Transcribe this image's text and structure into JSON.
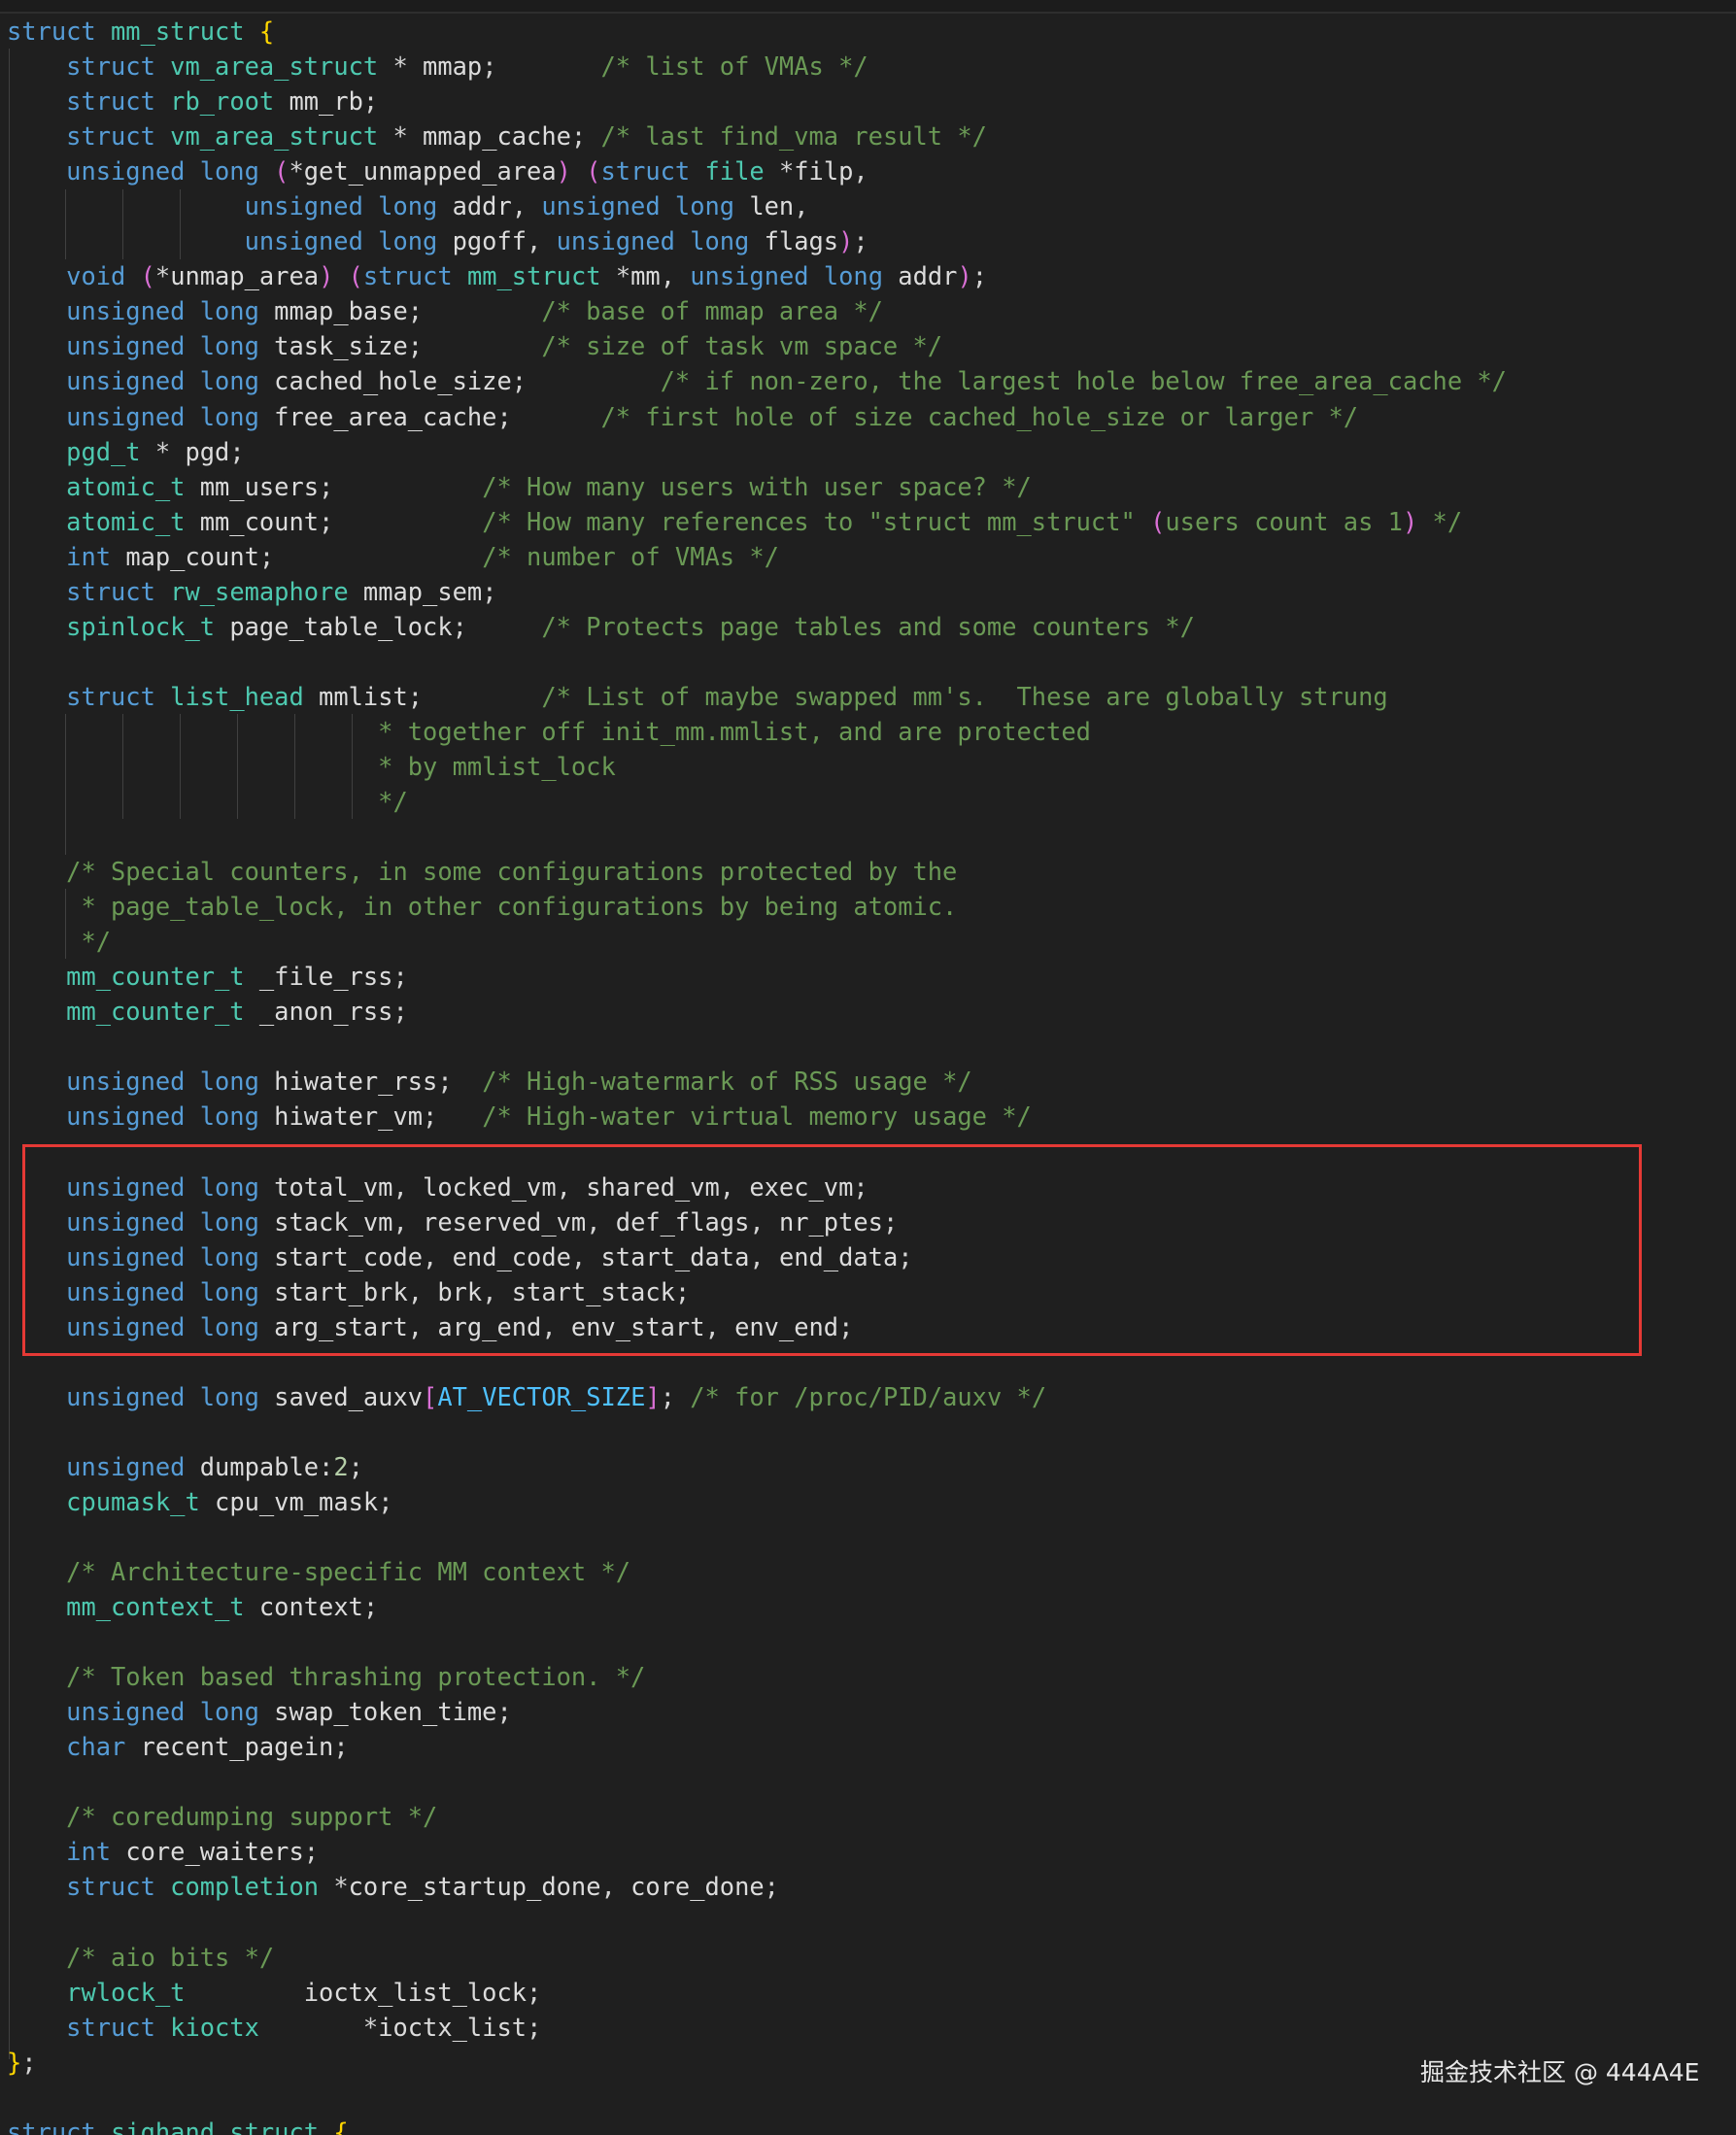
{
  "watermark": "掘金技术社区 @ 444A4E",
  "code_lines": [
    [
      {
        "t": "struct ",
        "c": "kw"
      },
      {
        "t": "mm_struct ",
        "c": "tp"
      },
      {
        "t": "{",
        "c": "br1"
      }
    ],
    [
      {
        "t": "    ",
        "c": "pn"
      },
      {
        "t": "struct ",
        "c": "kw"
      },
      {
        "t": "vm_area_struct ",
        "c": "tp"
      },
      {
        "t": "* ",
        "c": "pn"
      },
      {
        "t": "mmap",
        "c": "id"
      },
      {
        "t": ";       ",
        "c": "pn"
      },
      {
        "t": "/* list of VMAs */",
        "c": "cm"
      }
    ],
    [
      {
        "t": "    ",
        "c": "pn"
      },
      {
        "t": "struct ",
        "c": "kw"
      },
      {
        "t": "rb_root ",
        "c": "tp"
      },
      {
        "t": "mm_rb",
        "c": "id"
      },
      {
        "t": ";",
        "c": "pn"
      }
    ],
    [
      {
        "t": "    ",
        "c": "pn"
      },
      {
        "t": "struct ",
        "c": "kw"
      },
      {
        "t": "vm_area_struct ",
        "c": "tp"
      },
      {
        "t": "* ",
        "c": "pn"
      },
      {
        "t": "mmap_cache",
        "c": "id"
      },
      {
        "t": "; ",
        "c": "pn"
      },
      {
        "t": "/* last find_vma result */",
        "c": "cm"
      }
    ],
    [
      {
        "t": "    ",
        "c": "pn"
      },
      {
        "t": "unsigned long ",
        "c": "kw"
      },
      {
        "t": "(",
        "c": "br2"
      },
      {
        "t": "*",
        "c": "pn"
      },
      {
        "t": "get_unmapped_area",
        "c": "id"
      },
      {
        "t": ") (",
        "c": "br2"
      },
      {
        "t": "struct ",
        "c": "kw"
      },
      {
        "t": "file ",
        "c": "tp"
      },
      {
        "t": "*",
        "c": "pn"
      },
      {
        "t": "filp",
        "c": "id"
      },
      {
        "t": ",",
        "c": "pn"
      }
    ],
    [
      {
        "t": "                ",
        "c": "pn"
      },
      {
        "t": "unsigned long ",
        "c": "kw"
      },
      {
        "t": "addr",
        "c": "id"
      },
      {
        "t": ", ",
        "c": "pn"
      },
      {
        "t": "unsigned long ",
        "c": "kw"
      },
      {
        "t": "len",
        "c": "id"
      },
      {
        "t": ",",
        "c": "pn"
      }
    ],
    [
      {
        "t": "                ",
        "c": "pn"
      },
      {
        "t": "unsigned long ",
        "c": "kw"
      },
      {
        "t": "pgoff",
        "c": "id"
      },
      {
        "t": ", ",
        "c": "pn"
      },
      {
        "t": "unsigned long ",
        "c": "kw"
      },
      {
        "t": "flags",
        "c": "id"
      },
      {
        "t": ")",
        "c": "br2"
      },
      {
        "t": ";",
        "c": "pn"
      }
    ],
    [
      {
        "t": "    ",
        "c": "pn"
      },
      {
        "t": "void ",
        "c": "kw"
      },
      {
        "t": "(",
        "c": "br2"
      },
      {
        "t": "*",
        "c": "pn"
      },
      {
        "t": "unmap_area",
        "c": "id"
      },
      {
        "t": ") (",
        "c": "br2"
      },
      {
        "t": "struct ",
        "c": "kw"
      },
      {
        "t": "mm_struct ",
        "c": "tp"
      },
      {
        "t": "*",
        "c": "pn"
      },
      {
        "t": "mm",
        "c": "id"
      },
      {
        "t": ", ",
        "c": "pn"
      },
      {
        "t": "unsigned long ",
        "c": "kw"
      },
      {
        "t": "addr",
        "c": "id"
      },
      {
        "t": ")",
        "c": "br2"
      },
      {
        "t": ";",
        "c": "pn"
      }
    ],
    [
      {
        "t": "    ",
        "c": "pn"
      },
      {
        "t": "unsigned long ",
        "c": "kw"
      },
      {
        "t": "mmap_base",
        "c": "id"
      },
      {
        "t": ";        ",
        "c": "pn"
      },
      {
        "t": "/* base of mmap area */",
        "c": "cm"
      }
    ],
    [
      {
        "t": "    ",
        "c": "pn"
      },
      {
        "t": "unsigned long ",
        "c": "kw"
      },
      {
        "t": "task_size",
        "c": "id"
      },
      {
        "t": ";        ",
        "c": "pn"
      },
      {
        "t": "/* size of task vm space */",
        "c": "cm"
      }
    ],
    [
      {
        "t": "    ",
        "c": "pn"
      },
      {
        "t": "unsigned long ",
        "c": "kw"
      },
      {
        "t": "cached_hole_size",
        "c": "id"
      },
      {
        "t": ";         ",
        "c": "pn"
      },
      {
        "t": "/* if non-zero, the largest hole below free_area_cache */",
        "c": "cm"
      }
    ],
    [
      {
        "t": "    ",
        "c": "pn"
      },
      {
        "t": "unsigned long ",
        "c": "kw"
      },
      {
        "t": "free_area_cache",
        "c": "id"
      },
      {
        "t": ";      ",
        "c": "pn"
      },
      {
        "t": "/* first hole of size cached_hole_size or larger */",
        "c": "cm"
      }
    ],
    [
      {
        "t": "    ",
        "c": "pn"
      },
      {
        "t": "pgd_t ",
        "c": "tp"
      },
      {
        "t": "* ",
        "c": "pn"
      },
      {
        "t": "pgd",
        "c": "id"
      },
      {
        "t": ";",
        "c": "pn"
      }
    ],
    [
      {
        "t": "    ",
        "c": "pn"
      },
      {
        "t": "atomic_t ",
        "c": "tp"
      },
      {
        "t": "mm_users",
        "c": "id"
      },
      {
        "t": ";          ",
        "c": "pn"
      },
      {
        "t": "/* How many users with user space? */",
        "c": "cm"
      }
    ],
    [
      {
        "t": "    ",
        "c": "pn"
      },
      {
        "t": "atomic_t ",
        "c": "tp"
      },
      {
        "t": "mm_count",
        "c": "id"
      },
      {
        "t": ";          ",
        "c": "pn"
      },
      {
        "t": "/* How many references to \"struct mm_struct\" ",
        "c": "cm"
      },
      {
        "t": "(",
        "c": "br2"
      },
      {
        "t": "users count as 1",
        "c": "cm"
      },
      {
        "t": ")",
        "c": "br2"
      },
      {
        "t": " */",
        "c": "cm"
      }
    ],
    [
      {
        "t": "    ",
        "c": "pn"
      },
      {
        "t": "int ",
        "c": "kw"
      },
      {
        "t": "map_count",
        "c": "id"
      },
      {
        "t": ";              ",
        "c": "pn"
      },
      {
        "t": "/* number of VMAs */",
        "c": "cm"
      }
    ],
    [
      {
        "t": "    ",
        "c": "pn"
      },
      {
        "t": "struct ",
        "c": "kw"
      },
      {
        "t": "rw_semaphore ",
        "c": "tp"
      },
      {
        "t": "mmap_sem",
        "c": "id"
      },
      {
        "t": ";",
        "c": "pn"
      }
    ],
    [
      {
        "t": "    ",
        "c": "pn"
      },
      {
        "t": "spinlock_t ",
        "c": "tp"
      },
      {
        "t": "page_table_lock",
        "c": "id"
      },
      {
        "t": ";     ",
        "c": "pn"
      },
      {
        "t": "/* Protects page tables and some counters */",
        "c": "cm"
      }
    ],
    [],
    [
      {
        "t": "    ",
        "c": "pn"
      },
      {
        "t": "struct ",
        "c": "kw"
      },
      {
        "t": "list_head ",
        "c": "tp"
      },
      {
        "t": "mmlist",
        "c": "id"
      },
      {
        "t": ";        ",
        "c": "pn"
      },
      {
        "t": "/* List of maybe swapped mm's.  These are globally strung",
        "c": "cm"
      }
    ],
    [
      {
        "t": "                         ",
        "c": "pn"
      },
      {
        "t": "* together off init_mm.mmlist, and are protected",
        "c": "cm"
      }
    ],
    [
      {
        "t": "                         ",
        "c": "pn"
      },
      {
        "t": "* by mmlist_lock",
        "c": "cm"
      }
    ],
    [
      {
        "t": "                         ",
        "c": "pn"
      },
      {
        "t": "*/",
        "c": "cm"
      }
    ],
    [],
    [
      {
        "t": "    ",
        "c": "pn"
      },
      {
        "t": "/* Special counters, in some configurations protected by the",
        "c": "cm"
      }
    ],
    [
      {
        "t": "     ",
        "c": "pn"
      },
      {
        "t": "* page_table_lock, in other configurations by being atomic.",
        "c": "cm"
      }
    ],
    [
      {
        "t": "     ",
        "c": "pn"
      },
      {
        "t": "*/",
        "c": "cm"
      }
    ],
    [
      {
        "t": "    ",
        "c": "pn"
      },
      {
        "t": "mm_counter_t ",
        "c": "tp"
      },
      {
        "t": "_file_rss",
        "c": "id"
      },
      {
        "t": ";",
        "c": "pn"
      }
    ],
    [
      {
        "t": "    ",
        "c": "pn"
      },
      {
        "t": "mm_counter_t ",
        "c": "tp"
      },
      {
        "t": "_anon_rss",
        "c": "id"
      },
      {
        "t": ";",
        "c": "pn"
      }
    ],
    [],
    [
      {
        "t": "    ",
        "c": "pn"
      },
      {
        "t": "unsigned long ",
        "c": "kw"
      },
      {
        "t": "hiwater_rss",
        "c": "id"
      },
      {
        "t": ";  ",
        "c": "pn"
      },
      {
        "t": "/* High-watermark of RSS usage */",
        "c": "cm"
      }
    ],
    [
      {
        "t": "    ",
        "c": "pn"
      },
      {
        "t": "unsigned long ",
        "c": "kw"
      },
      {
        "t": "hiwater_vm",
        "c": "id"
      },
      {
        "t": ";   ",
        "c": "pn"
      },
      {
        "t": "/* High-water virtual memory usage */",
        "c": "cm"
      }
    ],
    [],
    [
      {
        "t": "    ",
        "c": "pn"
      },
      {
        "t": "unsigned long ",
        "c": "kw"
      },
      {
        "t": "total_vm",
        "c": "id"
      },
      {
        "t": ", ",
        "c": "pn"
      },
      {
        "t": "locked_vm",
        "c": "id"
      },
      {
        "t": ", ",
        "c": "pn"
      },
      {
        "t": "shared_vm",
        "c": "id"
      },
      {
        "t": ", ",
        "c": "pn"
      },
      {
        "t": "exec_vm",
        "c": "id"
      },
      {
        "t": ";",
        "c": "pn"
      }
    ],
    [
      {
        "t": "    ",
        "c": "pn"
      },
      {
        "t": "unsigned long ",
        "c": "kw"
      },
      {
        "t": "stack_vm",
        "c": "id"
      },
      {
        "t": ", ",
        "c": "pn"
      },
      {
        "t": "reserved_vm",
        "c": "id"
      },
      {
        "t": ", ",
        "c": "pn"
      },
      {
        "t": "def_flags",
        "c": "id"
      },
      {
        "t": ", ",
        "c": "pn"
      },
      {
        "t": "nr_ptes",
        "c": "id"
      },
      {
        "t": ";",
        "c": "pn"
      }
    ],
    [
      {
        "t": "    ",
        "c": "pn"
      },
      {
        "t": "unsigned long ",
        "c": "kw"
      },
      {
        "t": "start_code",
        "c": "id"
      },
      {
        "t": ", ",
        "c": "pn"
      },
      {
        "t": "end_code",
        "c": "id"
      },
      {
        "t": ", ",
        "c": "pn"
      },
      {
        "t": "start_data",
        "c": "id"
      },
      {
        "t": ", ",
        "c": "pn"
      },
      {
        "t": "end_data",
        "c": "id"
      },
      {
        "t": ";",
        "c": "pn"
      }
    ],
    [
      {
        "t": "    ",
        "c": "pn"
      },
      {
        "t": "unsigned long ",
        "c": "kw"
      },
      {
        "t": "start_brk",
        "c": "id"
      },
      {
        "t": ", ",
        "c": "pn"
      },
      {
        "t": "brk",
        "c": "id"
      },
      {
        "t": ", ",
        "c": "pn"
      },
      {
        "t": "start_stack",
        "c": "id"
      },
      {
        "t": ";",
        "c": "pn"
      }
    ],
    [
      {
        "t": "    ",
        "c": "pn"
      },
      {
        "t": "unsigned long ",
        "c": "kw"
      },
      {
        "t": "arg_start",
        "c": "id"
      },
      {
        "t": ", ",
        "c": "pn"
      },
      {
        "t": "arg_end",
        "c": "id"
      },
      {
        "t": ", ",
        "c": "pn"
      },
      {
        "t": "env_start",
        "c": "id"
      },
      {
        "t": ", ",
        "c": "pn"
      },
      {
        "t": "env_end",
        "c": "id"
      },
      {
        "t": ";",
        "c": "pn"
      }
    ],
    [],
    [
      {
        "t": "    ",
        "c": "pn"
      },
      {
        "t": "unsigned long ",
        "c": "kw"
      },
      {
        "t": "saved_auxv",
        "c": "id"
      },
      {
        "t": "[",
        "c": "br2"
      },
      {
        "t": "AT_VECTOR_SIZE",
        "c": "mac"
      },
      {
        "t": "]",
        "c": "br2"
      },
      {
        "t": "; ",
        "c": "pn"
      },
      {
        "t": "/* for /proc/PID/auxv */",
        "c": "cm"
      }
    ],
    [],
    [
      {
        "t": "    ",
        "c": "pn"
      },
      {
        "t": "unsigned ",
        "c": "kw"
      },
      {
        "t": "dumpable",
        "c": "id"
      },
      {
        "t": ":",
        "c": "pn"
      },
      {
        "t": "2",
        "c": "num"
      },
      {
        "t": ";",
        "c": "pn"
      }
    ],
    [
      {
        "t": "    ",
        "c": "pn"
      },
      {
        "t": "cpumask_t ",
        "c": "tp"
      },
      {
        "t": "cpu_vm_mask",
        "c": "id"
      },
      {
        "t": ";",
        "c": "pn"
      }
    ],
    [],
    [
      {
        "t": "    ",
        "c": "pn"
      },
      {
        "t": "/* Architecture-specific MM context */",
        "c": "cm"
      }
    ],
    [
      {
        "t": "    ",
        "c": "pn"
      },
      {
        "t": "mm_context_t ",
        "c": "tp"
      },
      {
        "t": "context",
        "c": "id"
      },
      {
        "t": ";",
        "c": "pn"
      }
    ],
    [],
    [
      {
        "t": "    ",
        "c": "pn"
      },
      {
        "t": "/* Token based thrashing protection. */",
        "c": "cm"
      }
    ],
    [
      {
        "t": "    ",
        "c": "pn"
      },
      {
        "t": "unsigned long ",
        "c": "kw"
      },
      {
        "t": "swap_token_time",
        "c": "id"
      },
      {
        "t": ";",
        "c": "pn"
      }
    ],
    [
      {
        "t": "    ",
        "c": "pn"
      },
      {
        "t": "char ",
        "c": "kw"
      },
      {
        "t": "recent_pagein",
        "c": "id"
      },
      {
        "t": ";",
        "c": "pn"
      }
    ],
    [],
    [
      {
        "t": "    ",
        "c": "pn"
      },
      {
        "t": "/* coredumping support */",
        "c": "cm"
      }
    ],
    [
      {
        "t": "    ",
        "c": "pn"
      },
      {
        "t": "int ",
        "c": "kw"
      },
      {
        "t": "core_waiters",
        "c": "id"
      },
      {
        "t": ";",
        "c": "pn"
      }
    ],
    [
      {
        "t": "    ",
        "c": "pn"
      },
      {
        "t": "struct ",
        "c": "kw"
      },
      {
        "t": "completion ",
        "c": "tp"
      },
      {
        "t": "*",
        "c": "pn"
      },
      {
        "t": "core_startup_done",
        "c": "id"
      },
      {
        "t": ", ",
        "c": "pn"
      },
      {
        "t": "core_done",
        "c": "id"
      },
      {
        "t": ";",
        "c": "pn"
      }
    ],
    [],
    [
      {
        "t": "    ",
        "c": "pn"
      },
      {
        "t": "/* aio bits */",
        "c": "cm"
      }
    ],
    [
      {
        "t": "    ",
        "c": "pn"
      },
      {
        "t": "rwlock_t        ",
        "c": "tp"
      },
      {
        "t": "ioctx_list_lock",
        "c": "id"
      },
      {
        "t": ";",
        "c": "pn"
      }
    ],
    [
      {
        "t": "    ",
        "c": "pn"
      },
      {
        "t": "struct ",
        "c": "kw"
      },
      {
        "t": "kioctx       ",
        "c": "tp"
      },
      {
        "t": "*",
        "c": "pn"
      },
      {
        "t": "ioctx_list",
        "c": "id"
      },
      {
        "t": ";",
        "c": "pn"
      }
    ],
    [
      {
        "t": "}",
        "c": "br1"
      },
      {
        "t": ";",
        "c": "pn"
      }
    ],
    [],
    [
      {
        "t": "struct ",
        "c": "kw"
      },
      {
        "t": "sighand_struct ",
        "c": "tp"
      },
      {
        "t": "{",
        "c": "br1"
      }
    ]
  ]
}
